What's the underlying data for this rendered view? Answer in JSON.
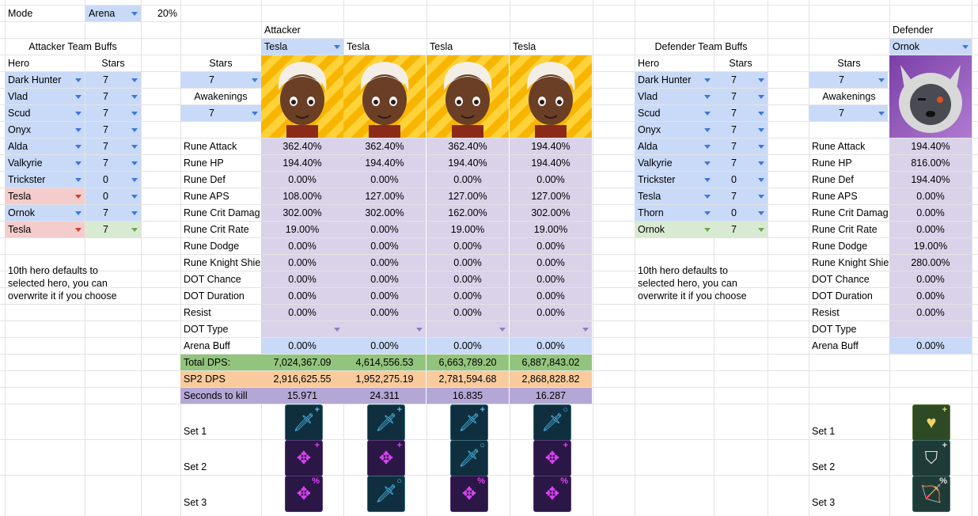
{
  "mode": {
    "label": "Mode",
    "value": "Arena",
    "pct": "20%"
  },
  "attacker": {
    "header": "Attacker",
    "team_buffs_title": "Attacker Team Buffs",
    "col_hero": "Hero",
    "col_stars": "Stars",
    "team": [
      {
        "hero": "Dark Hunter",
        "stars": "7",
        "color": "blue"
      },
      {
        "hero": "Vlad",
        "stars": "7",
        "color": "blue"
      },
      {
        "hero": "Scud",
        "stars": "7",
        "color": "blue"
      },
      {
        "hero": "Onyx",
        "stars": "7",
        "color": "blue"
      },
      {
        "hero": "Alda",
        "stars": "7",
        "color": "blue"
      },
      {
        "hero": "Valkyrie",
        "stars": "7",
        "color": "blue"
      },
      {
        "hero": "Trickster",
        "stars": "0",
        "color": "blue"
      },
      {
        "hero": "Tesla",
        "stars": "0",
        "color": "red"
      },
      {
        "hero": "Ornok",
        "stars": "7",
        "color": "blue"
      },
      {
        "hero": "Tesla",
        "stars": "7",
        "color": "red-green"
      }
    ],
    "note": "10th hero defaults to selected hero, you can overwrite it if you choose",
    "stars_label": "Stars",
    "stars_value": "7",
    "awakenings_label": "Awakenings",
    "awakenings_value": "7",
    "heroes": [
      "Tesla",
      "Tesla",
      "Tesla",
      "Tesla"
    ]
  },
  "row_labels": [
    "Rune Attack",
    "Rune HP",
    "Rune Def",
    "Rune APS",
    "Rune Crit Damag",
    "Rune Crit Rate",
    "Rune Dodge",
    "Rune Knight Shie",
    "DOT Chance",
    "DOT Duration",
    "Resist",
    "DOT Type",
    "Arena Buff"
  ],
  "attacker_values": [
    [
      "362.40%",
      "362.40%",
      "362.40%",
      "194.40%"
    ],
    [
      "194.40%",
      "194.40%",
      "194.40%",
      "194.40%"
    ],
    [
      "0.00%",
      "0.00%",
      "0.00%",
      "0.00%"
    ],
    [
      "108.00%",
      "127.00%",
      "127.00%",
      "127.00%"
    ],
    [
      "302.00%",
      "302.00%",
      "162.00%",
      "302.00%"
    ],
    [
      "19.00%",
      "0.00%",
      "19.00%",
      "19.00%"
    ],
    [
      "0.00%",
      "0.00%",
      "0.00%",
      "0.00%"
    ],
    [
      "0.00%",
      "0.00%",
      "0.00%",
      "0.00%"
    ],
    [
      "0.00%",
      "0.00%",
      "0.00%",
      "0.00%"
    ],
    [
      "0.00%",
      "0.00%",
      "0.00%",
      "0.00%"
    ],
    [
      "0.00%",
      "0.00%",
      "0.00%",
      "0.00%"
    ],
    [
      "",
      "",
      "",
      ""
    ],
    [
      "0.00%",
      "0.00%",
      "0.00%",
      "0.00%"
    ]
  ],
  "results": {
    "total_label": "Total DPS:",
    "total": [
      "7,024,367.09",
      "4,614,556.53",
      "6,663,789.20",
      "6,887,843.02"
    ],
    "sp2_label": "SP2 DPS",
    "sp2": [
      "2,916,625.55",
      "1,952,275.19",
      "2,781,594.68",
      "2,868,828.82"
    ],
    "sec_label": "Seconds to kill",
    "sec": [
      "15.971",
      "24.311",
      "16.835",
      "16.287"
    ]
  },
  "set_labels": [
    "Set 1",
    "Set 2",
    "Set 3"
  ],
  "attacker_sets": [
    [
      {
        "icon": "sword-icon",
        "tone": "blue",
        "badge": "+"
      },
      {
        "icon": "sword-icon",
        "tone": "blue",
        "badge": "+"
      },
      {
        "icon": "sword-icon",
        "tone": "blue",
        "badge": "+"
      },
      {
        "icon": "sword-icon",
        "tone": "blue",
        "badge": "○"
      }
    ],
    [
      {
        "icon": "crosshair-icon",
        "tone": "purple",
        "badge": "+"
      },
      {
        "icon": "crosshair-icon",
        "tone": "purple",
        "badge": "+"
      },
      {
        "icon": "sword-icon",
        "tone": "blue",
        "badge": "○"
      },
      {
        "icon": "crosshair-icon",
        "tone": "purple",
        "badge": "+"
      }
    ],
    [
      {
        "icon": "crosshair-icon",
        "tone": "purple",
        "badge": "%"
      },
      {
        "icon": "sword-icon",
        "tone": "blue",
        "badge": "○"
      },
      {
        "icon": "crosshair-icon",
        "tone": "purple",
        "badge": "%"
      },
      {
        "icon": "crosshair-icon",
        "tone": "purple",
        "badge": "%"
      }
    ]
  ],
  "defender": {
    "header": "Defender",
    "team_buffs_title": "Defender Team Buffs",
    "col_hero": "Hero",
    "col_stars": "Stars",
    "team": [
      {
        "hero": "Dark Hunter",
        "stars": "7",
        "color": "blue"
      },
      {
        "hero": "Vlad",
        "stars": "7",
        "color": "blue"
      },
      {
        "hero": "Scud",
        "stars": "7",
        "color": "blue"
      },
      {
        "hero": "Onyx",
        "stars": "7",
        "color": "blue"
      },
      {
        "hero": "Alda",
        "stars": "7",
        "color": "blue"
      },
      {
        "hero": "Valkyrie",
        "stars": "7",
        "color": "blue"
      },
      {
        "hero": "Trickster",
        "stars": "0",
        "color": "blue"
      },
      {
        "hero": "Tesla",
        "stars": "7",
        "color": "blue"
      },
      {
        "hero": "Thorn",
        "stars": "0",
        "color": "blue"
      },
      {
        "hero": "Ornok",
        "stars": "7",
        "color": "green"
      }
    ],
    "note": "10th hero defaults to selected hero, you can overwrite it if you choose",
    "stars_label": "Stars",
    "stars_value": "7",
    "awakenings_label": "Awakenings",
    "awakenings_value": "7",
    "hero": "Ornok",
    "row_labels": [
      "Rune Attack",
      "Rune HP",
      "Rune Def",
      "Rune APS",
      "Rune Crit Damag",
      "Rune Crit Rate",
      "Rune Dodge",
      "Rune Knight Shie",
      "DOT Chance",
      "DOT Duration",
      "Resist",
      "DOT Type",
      "Arena Buff"
    ],
    "values": [
      "194.40%",
      "816.00%",
      "194.40%",
      "0.00%",
      "0.00%",
      "0.00%",
      "19.00%",
      "280.00%",
      "0.00%",
      "0.00%",
      "0.00%",
      "",
      "0.00%"
    ],
    "sets": [
      {
        "icon": "heart-icon",
        "tone": "green",
        "badge": "+"
      },
      {
        "icon": "shield-icon",
        "tone": "teal",
        "badge": "+"
      },
      {
        "icon": "archer-icon",
        "tone": "teal",
        "badge": "%"
      }
    ]
  },
  "colors": {
    "blue": "#c9daf8",
    "red": "#f4cccc",
    "green": "#d9ead3",
    "lavender": "#d9d2e9",
    "total": "#93c47d",
    "sp2": "#f9cb9c",
    "seconds": "#b4a7d6"
  }
}
